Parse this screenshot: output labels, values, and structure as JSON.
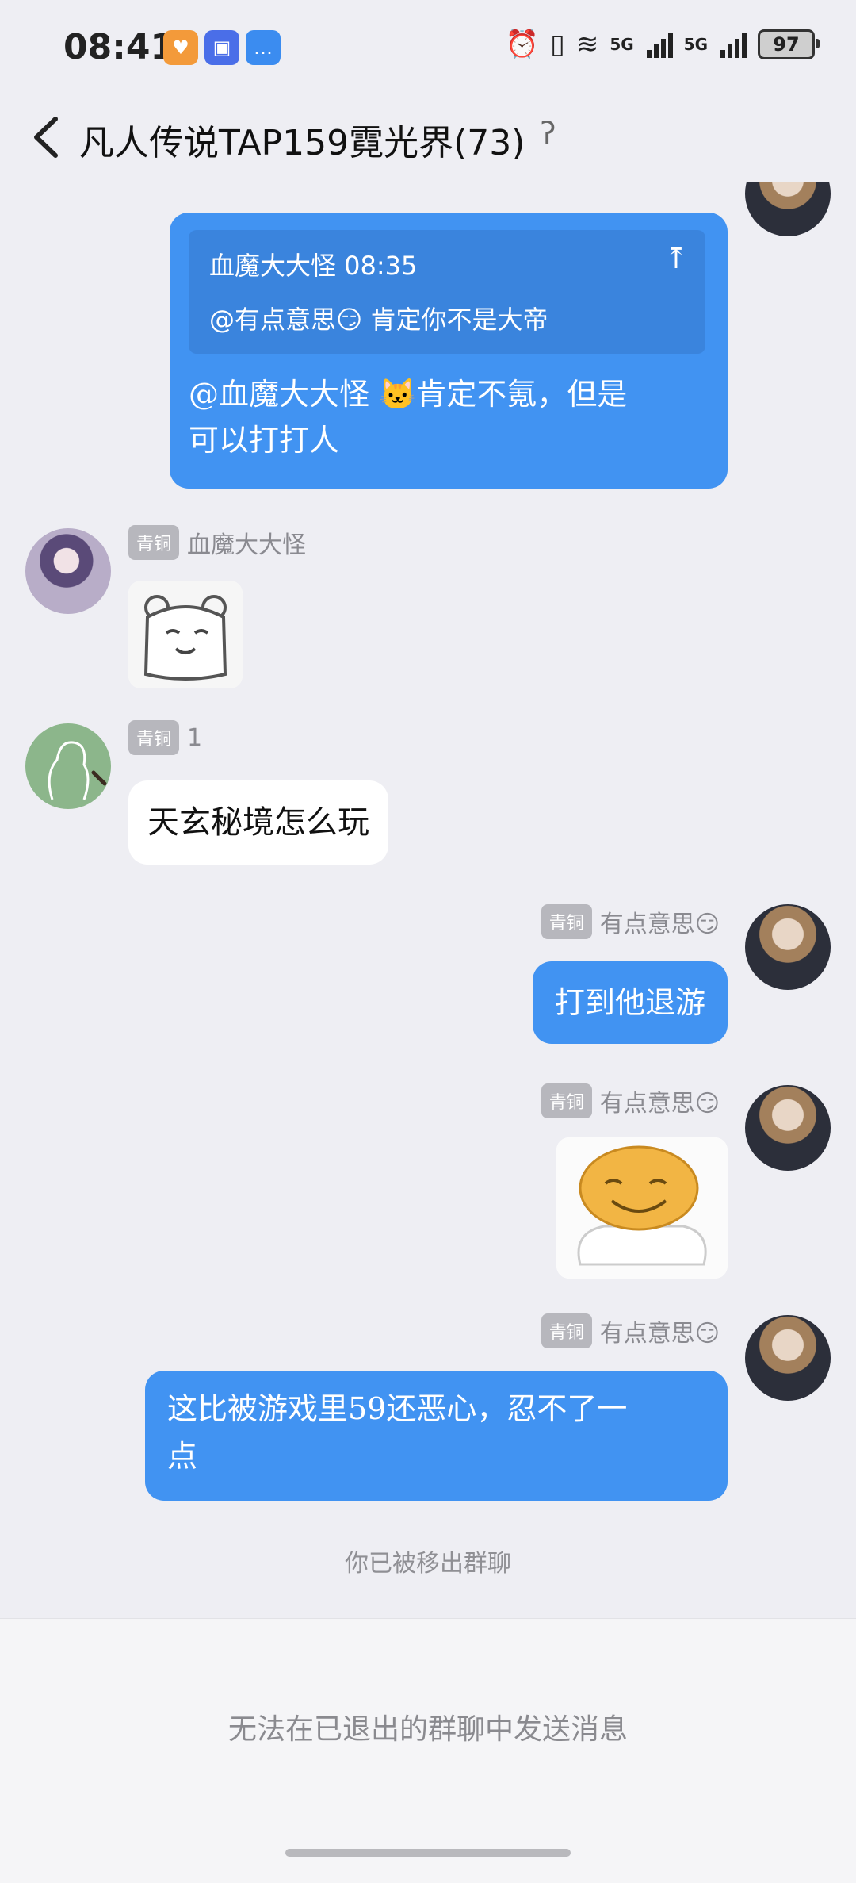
{
  "status_bar": {
    "time": "08:41",
    "app_icons": [
      "gift-app-icon",
      "app-market-icon",
      "messages-icon"
    ],
    "network_1": "5G",
    "network_2": "5G",
    "battery": "97"
  },
  "header": {
    "back_icon": "chevron-left-icon",
    "title": "凡人传说TAP159霓光界(73)",
    "ear_icon": "ear-icon"
  },
  "messages": [
    {
      "side": "right",
      "quote_author_time": "血魔大大怪 08:35",
      "quote_text": "@有点意思😏 肯定你不是大帝",
      "text_line1": "@血魔大大怪 🐱肯定不氪，但是",
      "text_line2": "可以打打人"
    },
    {
      "side": "left",
      "badge": "青铜",
      "sender": "血魔大大怪",
      "type": "sticker"
    },
    {
      "side": "left",
      "badge": "青铜",
      "sender": "1",
      "text": "天玄秘境怎么玩"
    },
    {
      "side": "right",
      "badge": "青铜",
      "sender": "有点意思😏",
      "text": "打到他退游"
    },
    {
      "side": "right",
      "badge": "青铜",
      "sender": "有点意思😏",
      "type": "sticker"
    },
    {
      "side": "right",
      "badge": "青铜",
      "sender": "有点意思😏",
      "text_line1": "这比被游戏里59还恶心，忍不了一",
      "text_line2": "点"
    }
  ],
  "system_notice": "你已被移出群聊",
  "footer": {
    "notice": "无法在已退出的群聊中发送消息"
  },
  "colors": {
    "accent": "#4193f2",
    "background": "#eeeef3",
    "badge": "#b7b7bd"
  }
}
